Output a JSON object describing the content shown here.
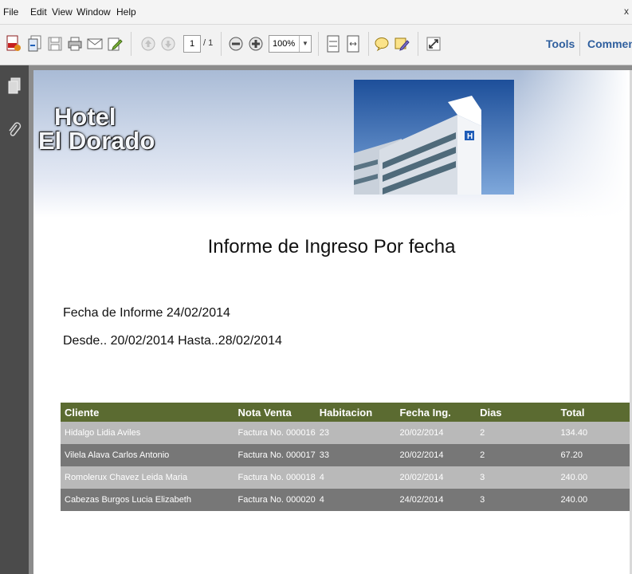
{
  "menu": [
    "File",
    "Edit",
    "View",
    "Window",
    "Help"
  ],
  "menu_close": "x",
  "toolbar": {
    "page_current": "1",
    "page_total": "/ 1",
    "zoom": "100%",
    "tools_label": "Tools",
    "comment_label": "Comment"
  },
  "header": {
    "hotel_line1": "Hotel",
    "hotel_line2": "El Dorado"
  },
  "report": {
    "title": "Informe de Ingreso Por fecha",
    "fecha_informe": "Fecha de Informe 24/02/2014",
    "rango": "Desde.. 20/02/2014  Hasta..28/02/2014"
  },
  "table": {
    "headers": [
      "Cliente",
      "Nota Venta",
      "Habitacion",
      "Fecha Ing.",
      "Dias",
      "Total"
    ],
    "rows": [
      [
        "Hidalgo Lidia Aviles",
        "Factura No. 000016",
        "23",
        "20/02/2014",
        "2",
        "134.40"
      ],
      [
        "Vilela Alava Carlos Antonio",
        "Factura No. 000017",
        "33",
        "20/02/2014",
        "2",
        "67.20"
      ],
      [
        "Romolerux Chavez Leida Maria",
        "Factura No. 000018",
        "4",
        "20/02/2014",
        "3",
        "240.00"
      ],
      [
        "Cabezas Burgos Lucia Elizabeth",
        "Factura No. 000020",
        "4",
        "24/02/2014",
        "3",
        "240.00"
      ]
    ]
  },
  "colors": {
    "table_header": "#5b6b31",
    "row_light": "#b9b9b9",
    "row_dark": "#777777",
    "link_blue": "#2f5f9e"
  }
}
